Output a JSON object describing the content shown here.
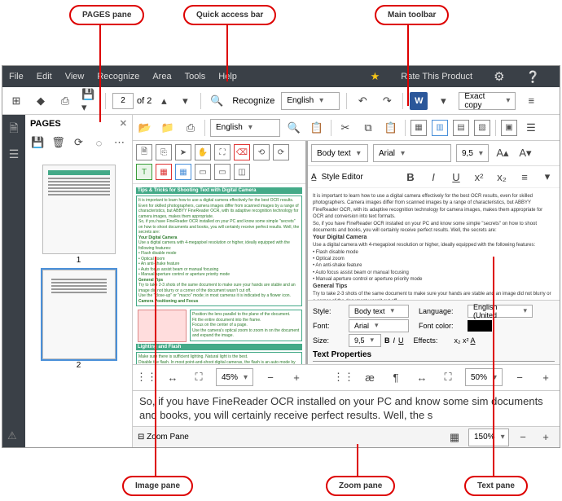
{
  "callouts": {
    "pages": "PAGES pane",
    "qab": "Quick access bar",
    "maintb": "Main toolbar",
    "imgpane": "Image pane",
    "zoompane": "Zoom pane",
    "txtpane": "Text pane"
  },
  "menu": {
    "file": "File",
    "edit": "Edit",
    "view": "View",
    "recognize": "Recognize",
    "area": "Area",
    "tools": "Tools",
    "help": "Help",
    "rate": "Rate This Product"
  },
  "qab": {
    "page_cur": "2",
    "page_of": "of 2",
    "recognize": "Recognize",
    "lang": "English",
    "mode": "Exact copy"
  },
  "maintb": {
    "lang": "English"
  },
  "pages": {
    "title": "PAGES",
    "n1": "1",
    "n2": "2"
  },
  "text": {
    "bodytext": "Body text",
    "arial": "Arial",
    "size": "9,5",
    "styleed": "Style Editor",
    "doc_title": "Your Digital Camera",
    "doc_gen": "General Tips",
    "imghdr": "Tips & Tricks for Shooting Text with Digital Camera",
    "lighting": "Lighting and Flash"
  },
  "props": {
    "style_l": "Style:",
    "style_v": "Body text",
    "font_l": "Font:",
    "font_v": "Arial",
    "size_l": "Size:",
    "size_v": "9,5",
    "lang_l": "Language:",
    "lang_v": "English (United",
    "color_l": "Font color:",
    "eff_l": "Effects:",
    "tab": "Text Properties"
  },
  "zoom": {
    "img": "45%",
    "txt": "50%",
    "pane": "Zoom Pane",
    "pane_v": "150%"
  },
  "big": "So, if you have FineReader OCR installed on your PC and know some sim documents and books, you will certainly receive perfect results. Well, the s"
}
